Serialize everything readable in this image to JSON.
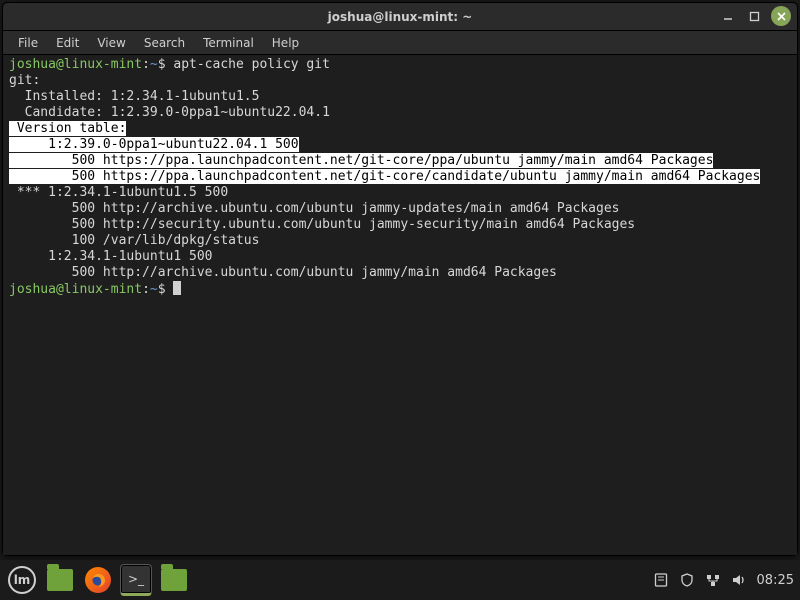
{
  "window": {
    "title": "joshua@linux-mint: ~"
  },
  "menu": {
    "file": "File",
    "edit": "Edit",
    "view": "View",
    "search": "Search",
    "terminal": "Terminal",
    "help": "Help"
  },
  "prompt": {
    "user": "joshua@linux-mint",
    "sep": ":",
    "path": "~",
    "dollar": "$"
  },
  "cmd1": "apt-cache policy git",
  "output": {
    "pkg": "git:",
    "installed": "  Installed: 1:2.34.1-1ubuntu1.5",
    "candidate": "  Candidate: 1:2.39.0-0ppa1~ubuntu22.04.1",
    "vt": " Version table:",
    "v1": "     1:2.39.0-0ppa1~ubuntu22.04.1 500",
    "v1a": "        500 https://ppa.launchpadcontent.net/git-core/ppa/ubuntu jammy/main amd64 Packages",
    "v1b": "        500 https://ppa.launchpadcontent.net/git-core/candidate/ubuntu jammy/main amd64 Packages",
    "v2": " *** 1:2.34.1-1ubuntu1.5 500",
    "v2a": "        500 http://archive.ubuntu.com/ubuntu jammy-updates/main amd64 Packages",
    "v2b": "        500 http://security.ubuntu.com/ubuntu jammy-security/main amd64 Packages",
    "v2c": "        100 /var/lib/dpkg/status",
    "v3": "     1:2.34.1-1ubuntu1 500",
    "v3a": "        500 http://archive.ubuntu.com/ubuntu jammy/main amd64 Packages"
  },
  "tray": {
    "clock": "08:25"
  }
}
